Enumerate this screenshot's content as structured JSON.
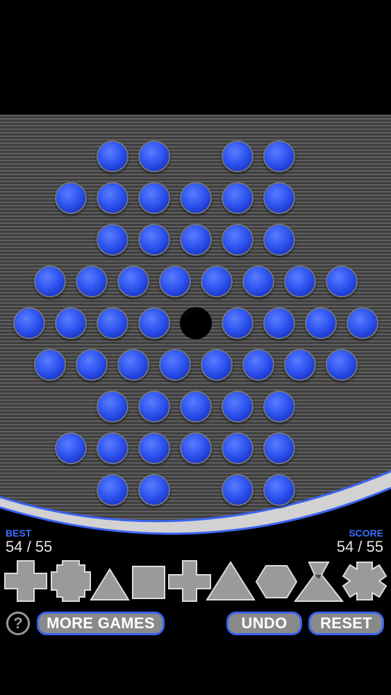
{
  "game": {
    "best_label": "BEST",
    "best_value": "54 / 55",
    "score_label": "SCORE",
    "score_value": "54 / 55",
    "peg_color": "#2f55f0",
    "accent_color": "#3a63f0",
    "board_rows": [
      "..PP.PP..",
      ".PPPPPP..",
      "..PPPPP..",
      "PPPPPPPP.",
      "PPPPOPPPP",
      "PPPPPPPP.",
      "..PPPPP..",
      ".PPPPPP..",
      "..PP.PP.."
    ],
    "board_legend": {
      "P": "peg",
      "O": "empty-hole",
      ".": "no-hole"
    }
  },
  "shapes": [
    {
      "name": "cross-shape-icon"
    },
    {
      "name": "octagon-shape-icon"
    },
    {
      "name": "triangle-small-shape-icon"
    },
    {
      "name": "square-shape-icon"
    },
    {
      "name": "plus-shape-icon"
    },
    {
      "name": "triangle-large-shape-icon"
    },
    {
      "name": "hexagon-shape-icon"
    },
    {
      "name": "hourglass-shape-icon"
    },
    {
      "name": "gear-shape-icon"
    }
  ],
  "buttons": {
    "help": "?",
    "more_games": "MORE GAMES",
    "undo": "UNDO",
    "reset": "RESET"
  }
}
